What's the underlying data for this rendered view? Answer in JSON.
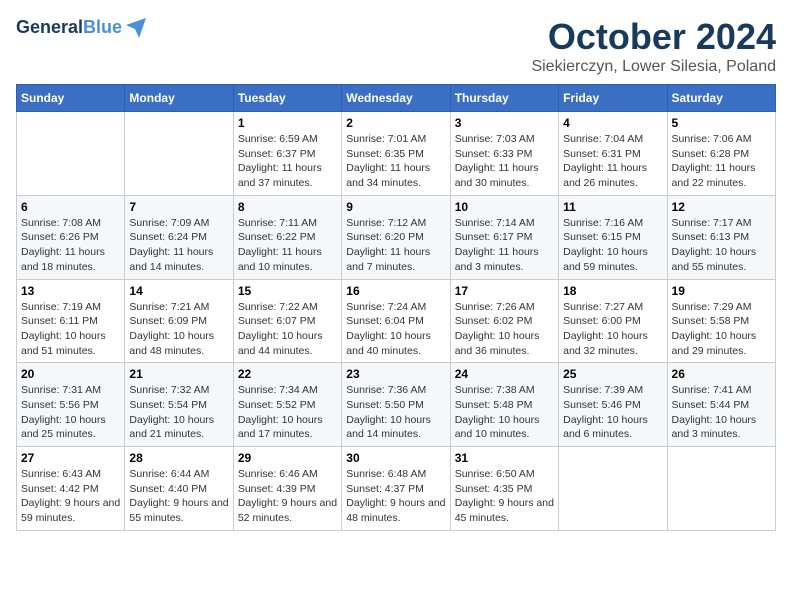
{
  "header": {
    "logo_line1": "General",
    "logo_line2": "Blue",
    "month": "October 2024",
    "location": "Siekierczyn, Lower Silesia, Poland"
  },
  "weekdays": [
    "Sunday",
    "Monday",
    "Tuesday",
    "Wednesday",
    "Thursday",
    "Friday",
    "Saturday"
  ],
  "weeks": [
    [
      {
        "day": "",
        "info": ""
      },
      {
        "day": "",
        "info": ""
      },
      {
        "day": "1",
        "info": "Sunrise: 6:59 AM\nSunset: 6:37 PM\nDaylight: 11 hours and 37 minutes."
      },
      {
        "day": "2",
        "info": "Sunrise: 7:01 AM\nSunset: 6:35 PM\nDaylight: 11 hours and 34 minutes."
      },
      {
        "day": "3",
        "info": "Sunrise: 7:03 AM\nSunset: 6:33 PM\nDaylight: 11 hours and 30 minutes."
      },
      {
        "day": "4",
        "info": "Sunrise: 7:04 AM\nSunset: 6:31 PM\nDaylight: 11 hours and 26 minutes."
      },
      {
        "day": "5",
        "info": "Sunrise: 7:06 AM\nSunset: 6:28 PM\nDaylight: 11 hours and 22 minutes."
      }
    ],
    [
      {
        "day": "6",
        "info": "Sunrise: 7:08 AM\nSunset: 6:26 PM\nDaylight: 11 hours and 18 minutes."
      },
      {
        "day": "7",
        "info": "Sunrise: 7:09 AM\nSunset: 6:24 PM\nDaylight: 11 hours and 14 minutes."
      },
      {
        "day": "8",
        "info": "Sunrise: 7:11 AM\nSunset: 6:22 PM\nDaylight: 11 hours and 10 minutes."
      },
      {
        "day": "9",
        "info": "Sunrise: 7:12 AM\nSunset: 6:20 PM\nDaylight: 11 hours and 7 minutes."
      },
      {
        "day": "10",
        "info": "Sunrise: 7:14 AM\nSunset: 6:17 PM\nDaylight: 11 hours and 3 minutes."
      },
      {
        "day": "11",
        "info": "Sunrise: 7:16 AM\nSunset: 6:15 PM\nDaylight: 10 hours and 59 minutes."
      },
      {
        "day": "12",
        "info": "Sunrise: 7:17 AM\nSunset: 6:13 PM\nDaylight: 10 hours and 55 minutes."
      }
    ],
    [
      {
        "day": "13",
        "info": "Sunrise: 7:19 AM\nSunset: 6:11 PM\nDaylight: 10 hours and 51 minutes."
      },
      {
        "day": "14",
        "info": "Sunrise: 7:21 AM\nSunset: 6:09 PM\nDaylight: 10 hours and 48 minutes."
      },
      {
        "day": "15",
        "info": "Sunrise: 7:22 AM\nSunset: 6:07 PM\nDaylight: 10 hours and 44 minutes."
      },
      {
        "day": "16",
        "info": "Sunrise: 7:24 AM\nSunset: 6:04 PM\nDaylight: 10 hours and 40 minutes."
      },
      {
        "day": "17",
        "info": "Sunrise: 7:26 AM\nSunset: 6:02 PM\nDaylight: 10 hours and 36 minutes."
      },
      {
        "day": "18",
        "info": "Sunrise: 7:27 AM\nSunset: 6:00 PM\nDaylight: 10 hours and 32 minutes."
      },
      {
        "day": "19",
        "info": "Sunrise: 7:29 AM\nSunset: 5:58 PM\nDaylight: 10 hours and 29 minutes."
      }
    ],
    [
      {
        "day": "20",
        "info": "Sunrise: 7:31 AM\nSunset: 5:56 PM\nDaylight: 10 hours and 25 minutes."
      },
      {
        "day": "21",
        "info": "Sunrise: 7:32 AM\nSunset: 5:54 PM\nDaylight: 10 hours and 21 minutes."
      },
      {
        "day": "22",
        "info": "Sunrise: 7:34 AM\nSunset: 5:52 PM\nDaylight: 10 hours and 17 minutes."
      },
      {
        "day": "23",
        "info": "Sunrise: 7:36 AM\nSunset: 5:50 PM\nDaylight: 10 hours and 14 minutes."
      },
      {
        "day": "24",
        "info": "Sunrise: 7:38 AM\nSunset: 5:48 PM\nDaylight: 10 hours and 10 minutes."
      },
      {
        "day": "25",
        "info": "Sunrise: 7:39 AM\nSunset: 5:46 PM\nDaylight: 10 hours and 6 minutes."
      },
      {
        "day": "26",
        "info": "Sunrise: 7:41 AM\nSunset: 5:44 PM\nDaylight: 10 hours and 3 minutes."
      }
    ],
    [
      {
        "day": "27",
        "info": "Sunrise: 6:43 AM\nSunset: 4:42 PM\nDaylight: 9 hours and 59 minutes."
      },
      {
        "day": "28",
        "info": "Sunrise: 6:44 AM\nSunset: 4:40 PM\nDaylight: 9 hours and 55 minutes."
      },
      {
        "day": "29",
        "info": "Sunrise: 6:46 AM\nSunset: 4:39 PM\nDaylight: 9 hours and 52 minutes."
      },
      {
        "day": "30",
        "info": "Sunrise: 6:48 AM\nSunset: 4:37 PM\nDaylight: 9 hours and 48 minutes."
      },
      {
        "day": "31",
        "info": "Sunrise: 6:50 AM\nSunset: 4:35 PM\nDaylight: 9 hours and 45 minutes."
      },
      {
        "day": "",
        "info": ""
      },
      {
        "day": "",
        "info": ""
      }
    ]
  ]
}
